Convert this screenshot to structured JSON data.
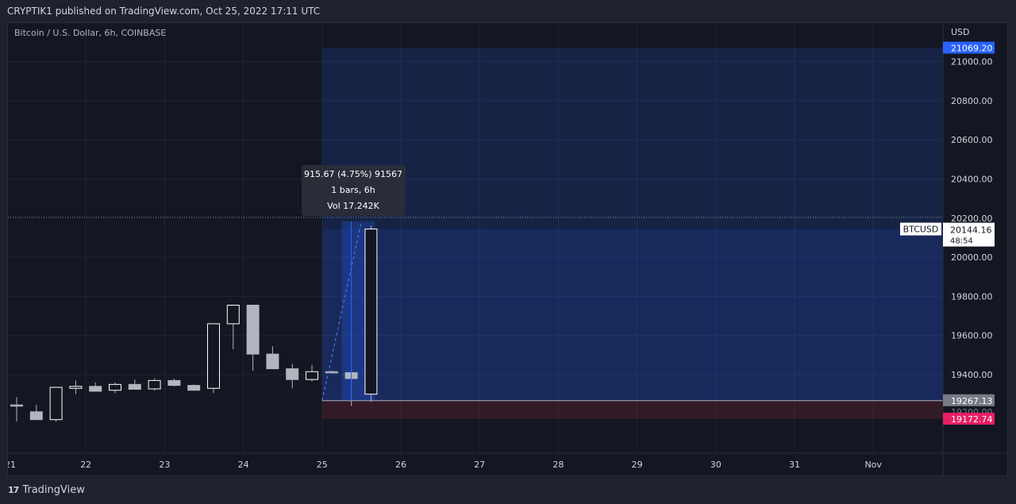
{
  "header": {
    "publisher_line": "CRYPTIK1 published on TradingView.com, Oct 25, 2022 17:11 UTC"
  },
  "footer": {
    "brand": "TradingView",
    "logo_icon": "tradingview-logo-icon"
  },
  "colors": {
    "background": "#131722",
    "grid": "#1f2433",
    "candle_up_body": "#131722",
    "candle_up_border": "#ffffff",
    "candle_down_body": "#b2b5be",
    "candle_down_border": "#b2b5be",
    "long_target_zone": "#2962ff",
    "stop_zone": "#f23645",
    "target_tag": "#2962ff",
    "stop_tag": "#e91e63",
    "entry_tag": "#787b86"
  },
  "chart_data": {
    "type": "candlestick",
    "symbol_line": "Bitcoin / U.S. Dollar, 6h, COINBASE",
    "currency": "USD",
    "x_axis_ticks": [
      "21",
      "22",
      "23",
      "24",
      "25",
      "26",
      "27",
      "28",
      "29",
      "30",
      "31",
      "Nov"
    ],
    "y_axis_ticks": [
      19400,
      19600,
      19800,
      20000,
      20200,
      20400,
      20600,
      20800,
      21000
    ],
    "y_tick_labels": [
      "19400.00",
      "19600.00",
      "19800.00",
      "20000.00",
      "20200.00",
      "20400.00",
      "20600.00",
      "20800.00",
      "21000.00"
    ],
    "ylim": [
      19150,
      21100
    ],
    "xlim_days": [
      21.0,
      32.9
    ],
    "grid": true,
    "candles": [
      {
        "t": 21.0,
        "o": 19245,
        "h": 19285,
        "l": 19160,
        "c": 19240
      },
      {
        "t": 21.25,
        "o": 19210,
        "h": 19245,
        "l": 19185,
        "c": 19170
      },
      {
        "t": 21.5,
        "o": 19170,
        "h": 19315,
        "l": 19160,
        "c": 19335
      },
      {
        "t": 21.75,
        "o": 19330,
        "h": 19370,
        "l": 19300,
        "c": 19340
      },
      {
        "t": 22.0,
        "o": 19340,
        "h": 19360,
        "l": 19320,
        "c": 19315
      },
      {
        "t": 22.25,
        "o": 19320,
        "h": 19360,
        "l": 19305,
        "c": 19350
      },
      {
        "t": 22.5,
        "o": 19350,
        "h": 19375,
        "l": 19325,
        "c": 19325
      },
      {
        "t": 22.75,
        "o": 19327,
        "h": 19380,
        "l": 19318,
        "c": 19370
      },
      {
        "t": 23.0,
        "o": 19370,
        "h": 19380,
        "l": 19340,
        "c": 19345
      },
      {
        "t": 23.25,
        "o": 19345,
        "h": 19350,
        "l": 19318,
        "c": 19320
      },
      {
        "t": 23.5,
        "o": 19330,
        "h": 19490,
        "l": 19305,
        "c": 19660
      },
      {
        "t": 23.75,
        "o": 19660,
        "h": 19695,
        "l": 19530,
        "c": 19755
      },
      {
        "t": 24.0,
        "o": 19755,
        "h": 19720,
        "l": 19420,
        "c": 19505
      },
      {
        "t": 24.25,
        "o": 19505,
        "h": 19545,
        "l": 19485,
        "c": 19430
      },
      {
        "t": 24.5,
        "o": 19430,
        "h": 19455,
        "l": 19330,
        "c": 19375
      },
      {
        "t": 24.75,
        "o": 19375,
        "h": 19450,
        "l": 19365,
        "c": 19415
      },
      {
        "t": 25.0,
        "o": 19415,
        "h": 19420,
        "l": 19408,
        "c": 19410
      },
      {
        "t": 25.25,
        "o": 19410,
        "h": 19420,
        "l": 19240,
        "c": 19380
      },
      {
        "t": 25.5,
        "o": 19300,
        "h": 20160,
        "l": 19260,
        "c": 20144.16
      }
    ],
    "position": {
      "type": "long",
      "entry": 19267.13,
      "target": 21069.2,
      "stop": 19172.74,
      "stop_partial_label": "19200.00",
      "start_day": 25.0,
      "end_day": 32.9
    },
    "current_price": {
      "symbol_tag": "BTCUSD",
      "price": "20144.16",
      "countdown": "48:54",
      "dotted_line_value": 20144.16
    },
    "price_tags": {
      "target": "21069.20",
      "entry": "19267.13",
      "stop": "19172.74"
    },
    "measure_tooltip": {
      "line1": "915.67 (4.75%) 91567",
      "line2": "1 bars, 6h",
      "line3": "Vol 17.242K",
      "from_value": 19267.13,
      "to_value": 20182.8,
      "from_day": 25.0,
      "to_day": 25.5
    }
  }
}
